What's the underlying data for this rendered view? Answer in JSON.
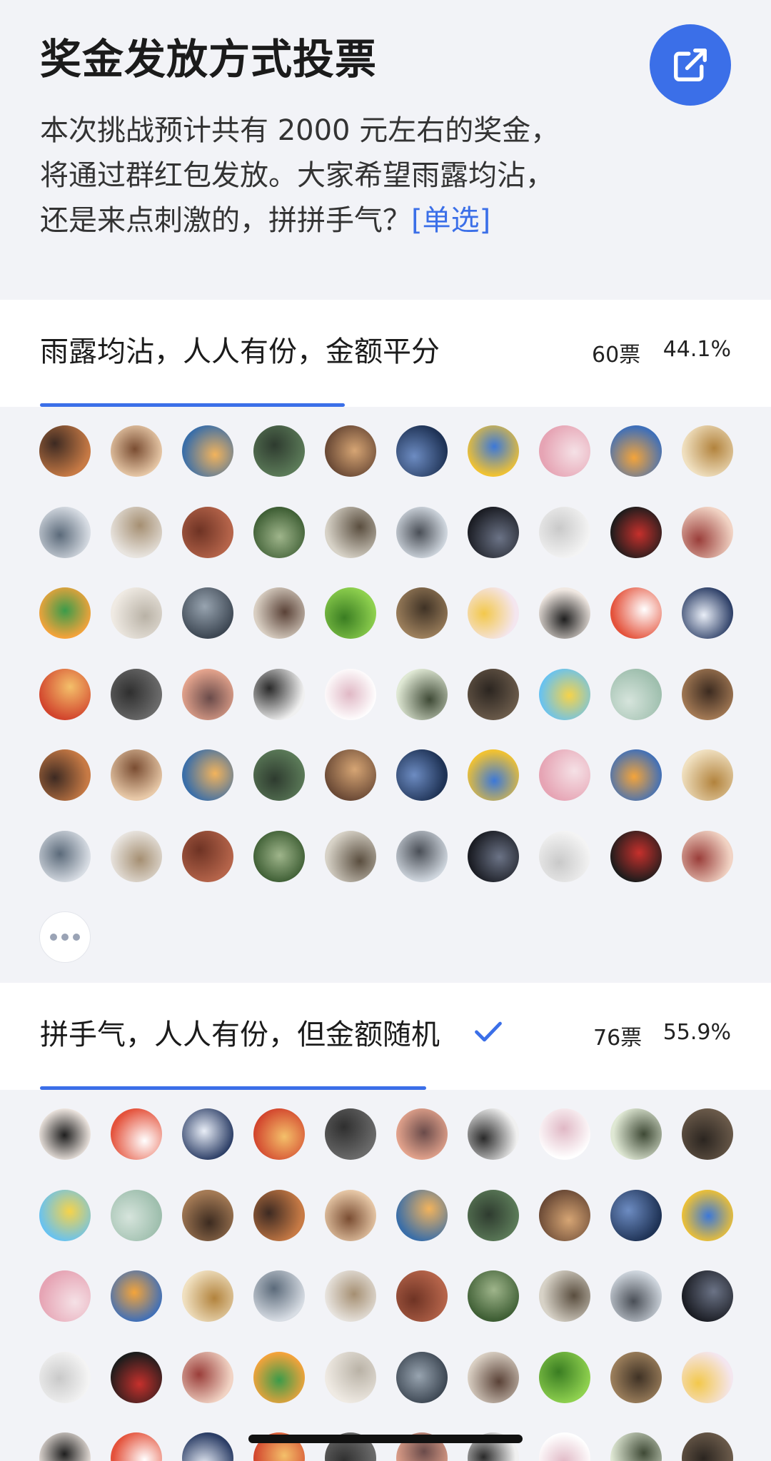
{
  "header": {
    "title": "奖金发放方式投票",
    "description_line1": "本次挑战预计共有 2000 元左右的奖金，",
    "description_line2": "将通过群红包发放。大家希望雨露均沾，",
    "description_line3": "还是来点刺激的，拼拼手气？",
    "tag": "[单选]",
    "share_icon": "external-link-icon"
  },
  "options": [
    {
      "label": "雨露均沾，人人有份，金额平分",
      "votes": "60票",
      "percent": "44.1%",
      "progress": 0.441,
      "selected": false
    },
    {
      "label": "拼手气，人人有份，但金额随机",
      "votes": "76票",
      "percent": "55.9%",
      "progress": 0.559,
      "selected": true
    }
  ],
  "colors": {
    "accent": "#3b6fe8",
    "background": "#f2f3f7",
    "card": "#ffffff"
  },
  "avatar_icon": "voter-avatar",
  "more_icon": "more-dots-icon"
}
